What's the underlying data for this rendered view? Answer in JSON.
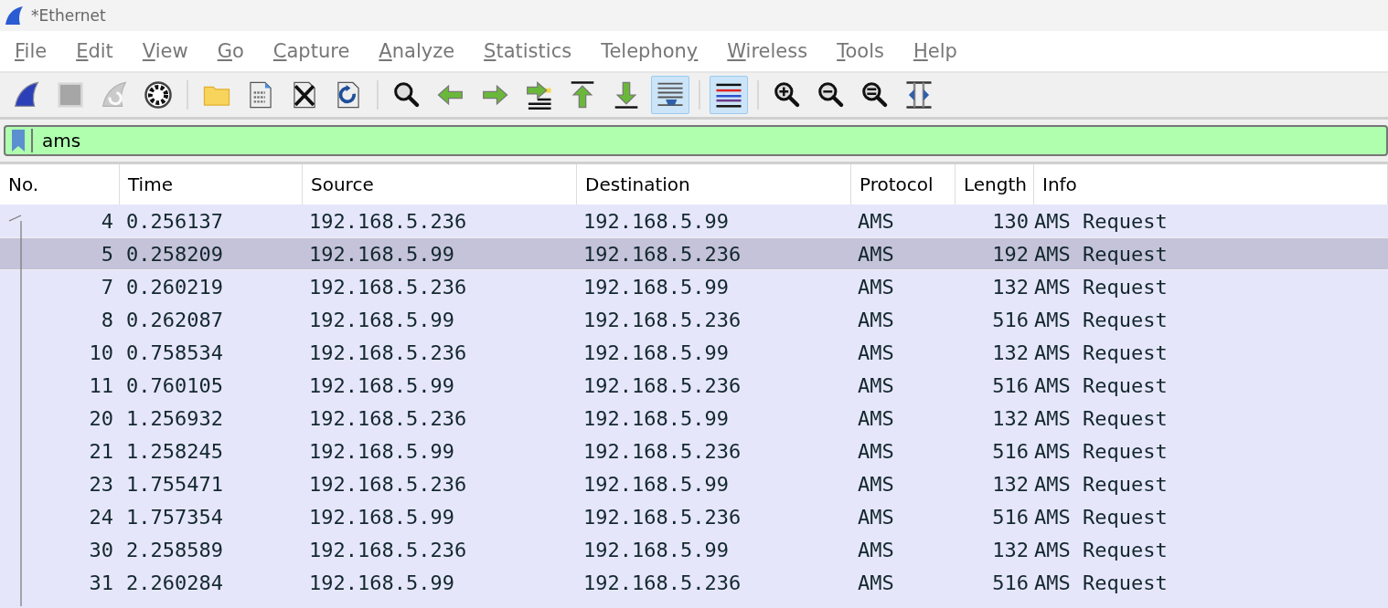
{
  "window": {
    "title": "*Ethernet"
  },
  "menu": [
    {
      "accel": "F",
      "rest": "ile"
    },
    {
      "accel": "E",
      "rest": "dit"
    },
    {
      "accel": "V",
      "rest": "iew"
    },
    {
      "accel": "G",
      "rest": "o"
    },
    {
      "accel": "C",
      "rest": "apture"
    },
    {
      "accel": "A",
      "rest": "nalyze"
    },
    {
      "accel": "S",
      "rest": "tatistics"
    },
    {
      "rest": "Telephon",
      "accel_after": "y"
    },
    {
      "accel": "W",
      "rest": "ireless"
    },
    {
      "accel": "T",
      "rest": "ools"
    },
    {
      "accel": "H",
      "rest": "elp"
    }
  ],
  "toolbar": [
    {
      "kind": "start",
      "disabled": false,
      "on": false
    },
    {
      "kind": "stop",
      "disabled": true,
      "on": false
    },
    {
      "kind": "restart",
      "disabled": true,
      "on": false
    },
    {
      "kind": "options",
      "disabled": false,
      "on": false
    },
    {
      "kind": "sep"
    },
    {
      "kind": "open",
      "disabled": false,
      "on": false
    },
    {
      "kind": "file",
      "disabled": false,
      "on": false
    },
    {
      "kind": "close",
      "disabled": false,
      "on": false
    },
    {
      "kind": "reload",
      "disabled": false,
      "on": false
    },
    {
      "kind": "sep"
    },
    {
      "kind": "find",
      "disabled": false,
      "on": false
    },
    {
      "kind": "back",
      "disabled": false,
      "on": false
    },
    {
      "kind": "forward",
      "disabled": false,
      "on": false
    },
    {
      "kind": "goto",
      "disabled": false,
      "on": false
    },
    {
      "kind": "first",
      "disabled": false,
      "on": false
    },
    {
      "kind": "last",
      "disabled": false,
      "on": false
    },
    {
      "kind": "autoscroll",
      "disabled": false,
      "on": true
    },
    {
      "kind": "sep"
    },
    {
      "kind": "colorize",
      "disabled": false,
      "on": true
    },
    {
      "kind": "sep"
    },
    {
      "kind": "zoomin",
      "disabled": false,
      "on": false
    },
    {
      "kind": "zoomout",
      "disabled": false,
      "on": false
    },
    {
      "kind": "zoomreset",
      "disabled": false,
      "on": false
    },
    {
      "kind": "resize",
      "disabled": false,
      "on": false
    }
  ],
  "filter": {
    "value": "ams"
  },
  "table": {
    "columns": [
      "No.",
      "Time",
      "Source",
      "Destination",
      "Protocol",
      "Length",
      "Info"
    ],
    "rows": [
      {
        "cells": [
          "4",
          "0.256137",
          "192.168.5.236",
          "192.168.5.99",
          "AMS",
          "130",
          "AMS Request"
        ],
        "selected": false
      },
      {
        "cells": [
          "5",
          "0.258209",
          "192.168.5.99",
          "192.168.5.236",
          "AMS",
          "192",
          "AMS Request"
        ],
        "selected": true
      },
      {
        "cells": [
          "7",
          "0.260219",
          "192.168.5.236",
          "192.168.5.99",
          "AMS",
          "132",
          "AMS Request"
        ],
        "selected": false
      },
      {
        "cells": [
          "8",
          "0.262087",
          "192.168.5.99",
          "192.168.5.236",
          "AMS",
          "516",
          "AMS Request"
        ],
        "selected": false
      },
      {
        "cells": [
          "10",
          "0.758534",
          "192.168.5.236",
          "192.168.5.99",
          "AMS",
          "132",
          "AMS Request"
        ],
        "selected": false
      },
      {
        "cells": [
          "11",
          "0.760105",
          "192.168.5.99",
          "192.168.5.236",
          "AMS",
          "516",
          "AMS Request"
        ],
        "selected": false
      },
      {
        "cells": [
          "20",
          "1.256932",
          "192.168.5.236",
          "192.168.5.99",
          "AMS",
          "132",
          "AMS Request"
        ],
        "selected": false
      },
      {
        "cells": [
          "21",
          "1.258245",
          "192.168.5.99",
          "192.168.5.236",
          "AMS",
          "516",
          "AMS Request"
        ],
        "selected": false
      },
      {
        "cells": [
          "23",
          "1.755471",
          "192.168.5.236",
          "192.168.5.99",
          "AMS",
          "132",
          "AMS Request"
        ],
        "selected": false
      },
      {
        "cells": [
          "24",
          "1.757354",
          "192.168.5.99",
          "192.168.5.236",
          "AMS",
          "516",
          "AMS Request"
        ],
        "selected": false
      },
      {
        "cells": [
          "30",
          "2.258589",
          "192.168.5.236",
          "192.168.5.99",
          "AMS",
          "132",
          "AMS Request"
        ],
        "selected": false
      },
      {
        "cells": [
          "31",
          "2.260284",
          "192.168.5.99",
          "192.168.5.236",
          "AMS",
          "516",
          "AMS Request"
        ],
        "selected": false
      }
    ]
  }
}
